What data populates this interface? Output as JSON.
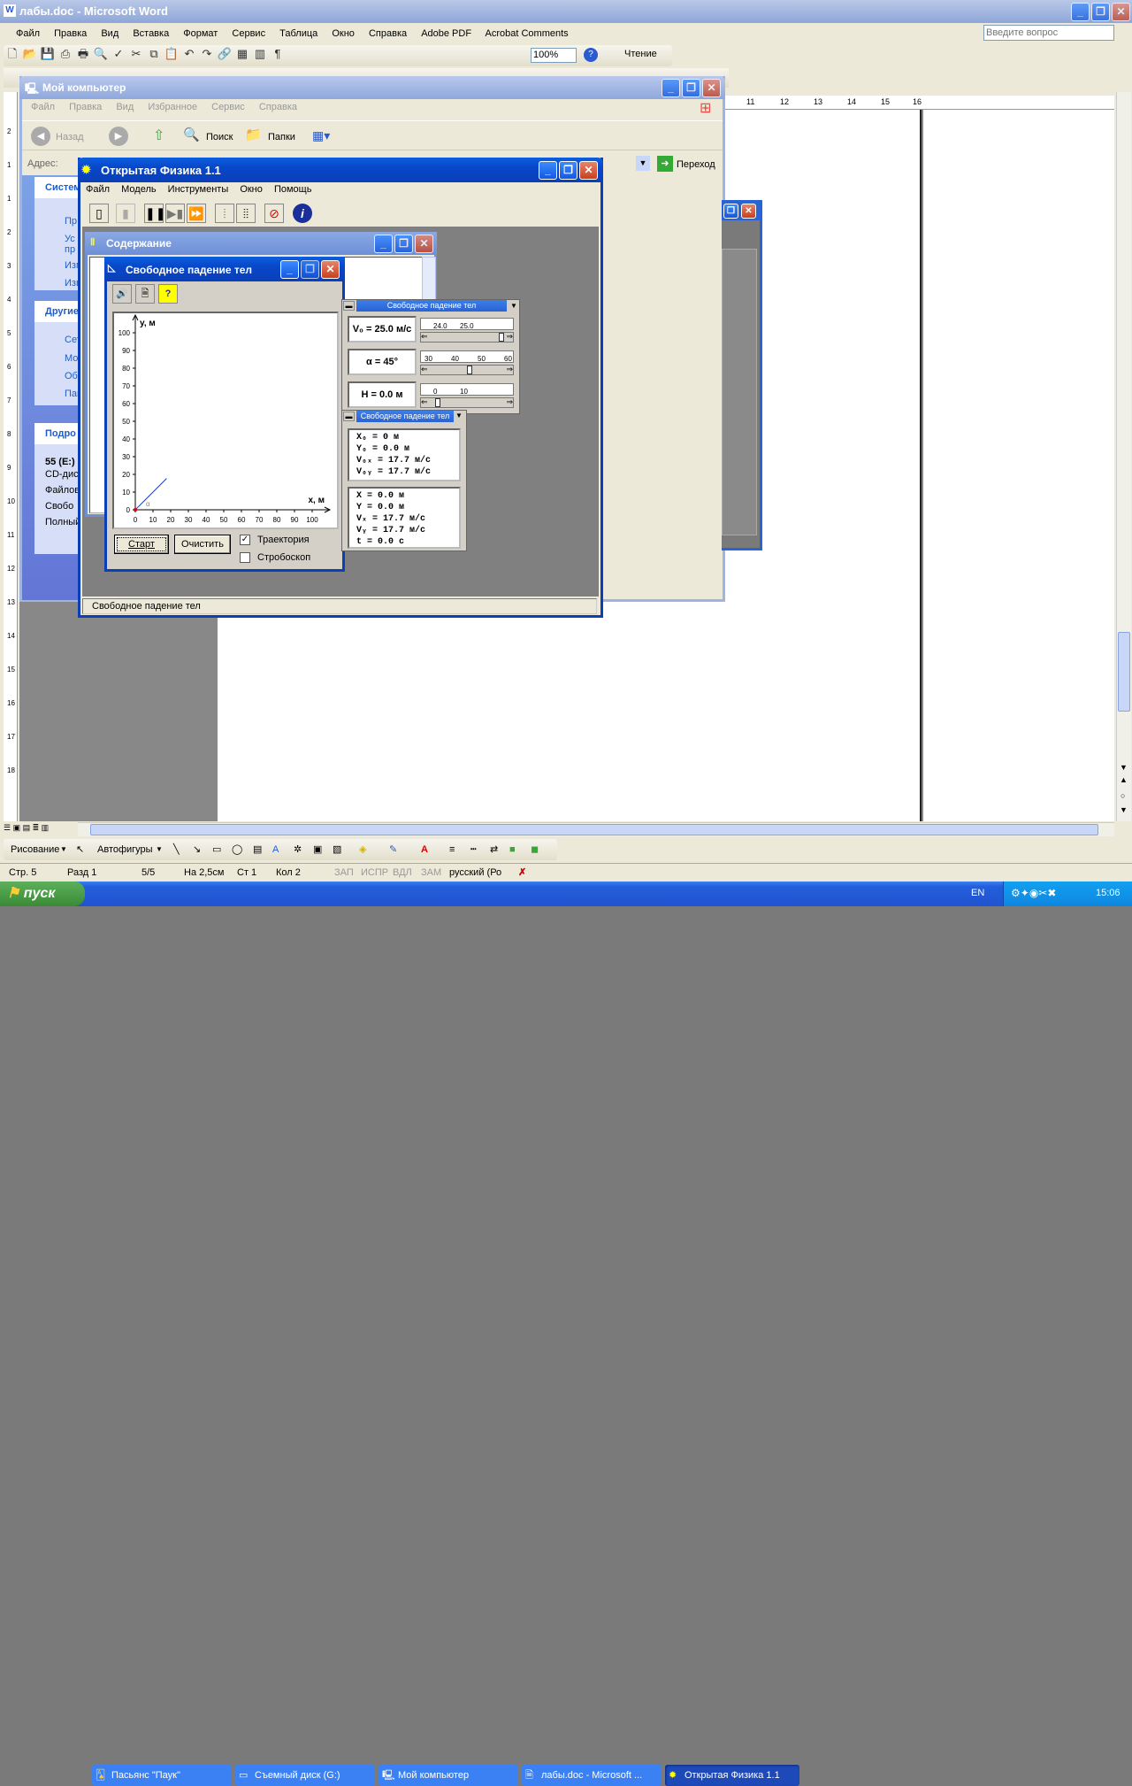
{
  "word": {
    "title": "лабы.doc - Microsoft Word",
    "menu": [
      "Файл",
      "Правка",
      "Вид",
      "Вставка",
      "Формат",
      "Сервис",
      "Таблица",
      "Окно",
      "Справка",
      "Adobe PDF",
      "Acrobat Comments"
    ],
    "help_placeholder": "Введите вопрос",
    "zoom": "100%",
    "read_label": "Чтение",
    "ruler_right": [
      "11",
      "12",
      "13",
      "14",
      "15",
      "16"
    ],
    "ruler_left": [
      "2",
      "1",
      "1",
      "2",
      "3",
      "4",
      "5",
      "6",
      "7",
      "8",
      "9",
      "10",
      "11",
      "12",
      "13",
      "14",
      "15",
      "16",
      "17",
      "18"
    ],
    "drawing": {
      "draw_label": "Рисование",
      "autoshapes_label": "Автофигуры"
    },
    "status": [
      "Стр. 5",
      "Разд 1",
      "5/5",
      "На 2,5см",
      "Ст 1",
      "Кол 2",
      "ЗАП",
      "ИСПР",
      "ВДЛ",
      "ЗАМ",
      "русский (Ро"
    ]
  },
  "explorer": {
    "title": "Мой компьютер",
    "menu": [
      "Файл",
      "Правка",
      "Вид",
      "Избранное",
      "Сервис",
      "Справка"
    ],
    "back": "Назад",
    "search": "Поиск",
    "folders": "Папки",
    "address_label": "Адрес:",
    "go": "Переход",
    "sections": [
      {
        "title": "Систем",
        "items": [
          "Пр",
          "Ус",
          "пр",
          "Изм",
          "Изв"
        ]
      },
      {
        "title": "Другие",
        "items": [
          "Сет",
          "Мо",
          "Об",
          "Пан"
        ]
      },
      {
        "title": "Подро",
        "items": [
          "55 (E:)",
          "CD-дис",
          "Файлов",
          "Свобо",
          "Полный"
        ]
      }
    ]
  },
  "physics": {
    "title": "Открытая Физика 1.1",
    "menu": [
      "Файл",
      "Модель",
      "Инструменты",
      "Окно",
      "Помощь"
    ],
    "status": "Свободное падение тел",
    "contents_title": "Содержание"
  },
  "model": {
    "title": "Свободное падение тел",
    "start": "Старт",
    "clear": "Очистить",
    "trajectory_label": "Траектория",
    "stroboscope_label": "Стробоскоп",
    "trajectory_checked": true,
    "stroboscope_checked": false
  },
  "chart_data": {
    "type": "line",
    "xlabel": "x, м",
    "ylabel": "y, м",
    "xlim": [
      0,
      110
    ],
    "ylim": [
      0,
      110
    ],
    "xticks": [
      0,
      10,
      20,
      30,
      40,
      50,
      60,
      70,
      80,
      90,
      100
    ],
    "yticks": [
      0,
      10,
      20,
      30,
      40,
      50,
      60,
      70,
      80,
      90,
      100
    ],
    "series": [
      {
        "x": [
          0,
          17.7
        ],
        "y": [
          0,
          17.7
        ]
      }
    ],
    "annotations": [
      "α"
    ]
  },
  "params": {
    "header": "Свободное падение тел",
    "rows": [
      {
        "label": "V₀ = 25.0 м/с",
        "scale": [
          "24.0",
          "25.0"
        ],
        "slider": 0.95
      },
      {
        "label": "α = 45°",
        "scale": [
          "30",
          "40",
          "50",
          "60"
        ],
        "slider": 0.5
      },
      {
        "label": "H = 0.0 м",
        "scale": [
          "0",
          "10"
        ],
        "slider": 0.05
      }
    ]
  },
  "values": {
    "header": "Свободное падение тел",
    "initial": [
      "X₀  = 0 м",
      "Y₀  = 0.0 м",
      "V₀ₓ = 17.7 м/с",
      "V₀ᵧ = 17.7 м/с"
    ],
    "current": [
      "X   = 0.0 м",
      "Y   = 0.0 м",
      "Vₓ  = 17.7 м/с",
      "Vᵧ  = 17.7 м/с",
      "t   = 0.0 с"
    ]
  },
  "taskbar": {
    "start": "пуск",
    "tasks": [
      "Пасьянс \"Паук\"",
      "Съемный диск (G:)",
      "Мой компьютер",
      "лабы.doc - Microsoft ...",
      "Открытая Физика 1.1"
    ],
    "lang": "EN",
    "clock": "15:06"
  }
}
